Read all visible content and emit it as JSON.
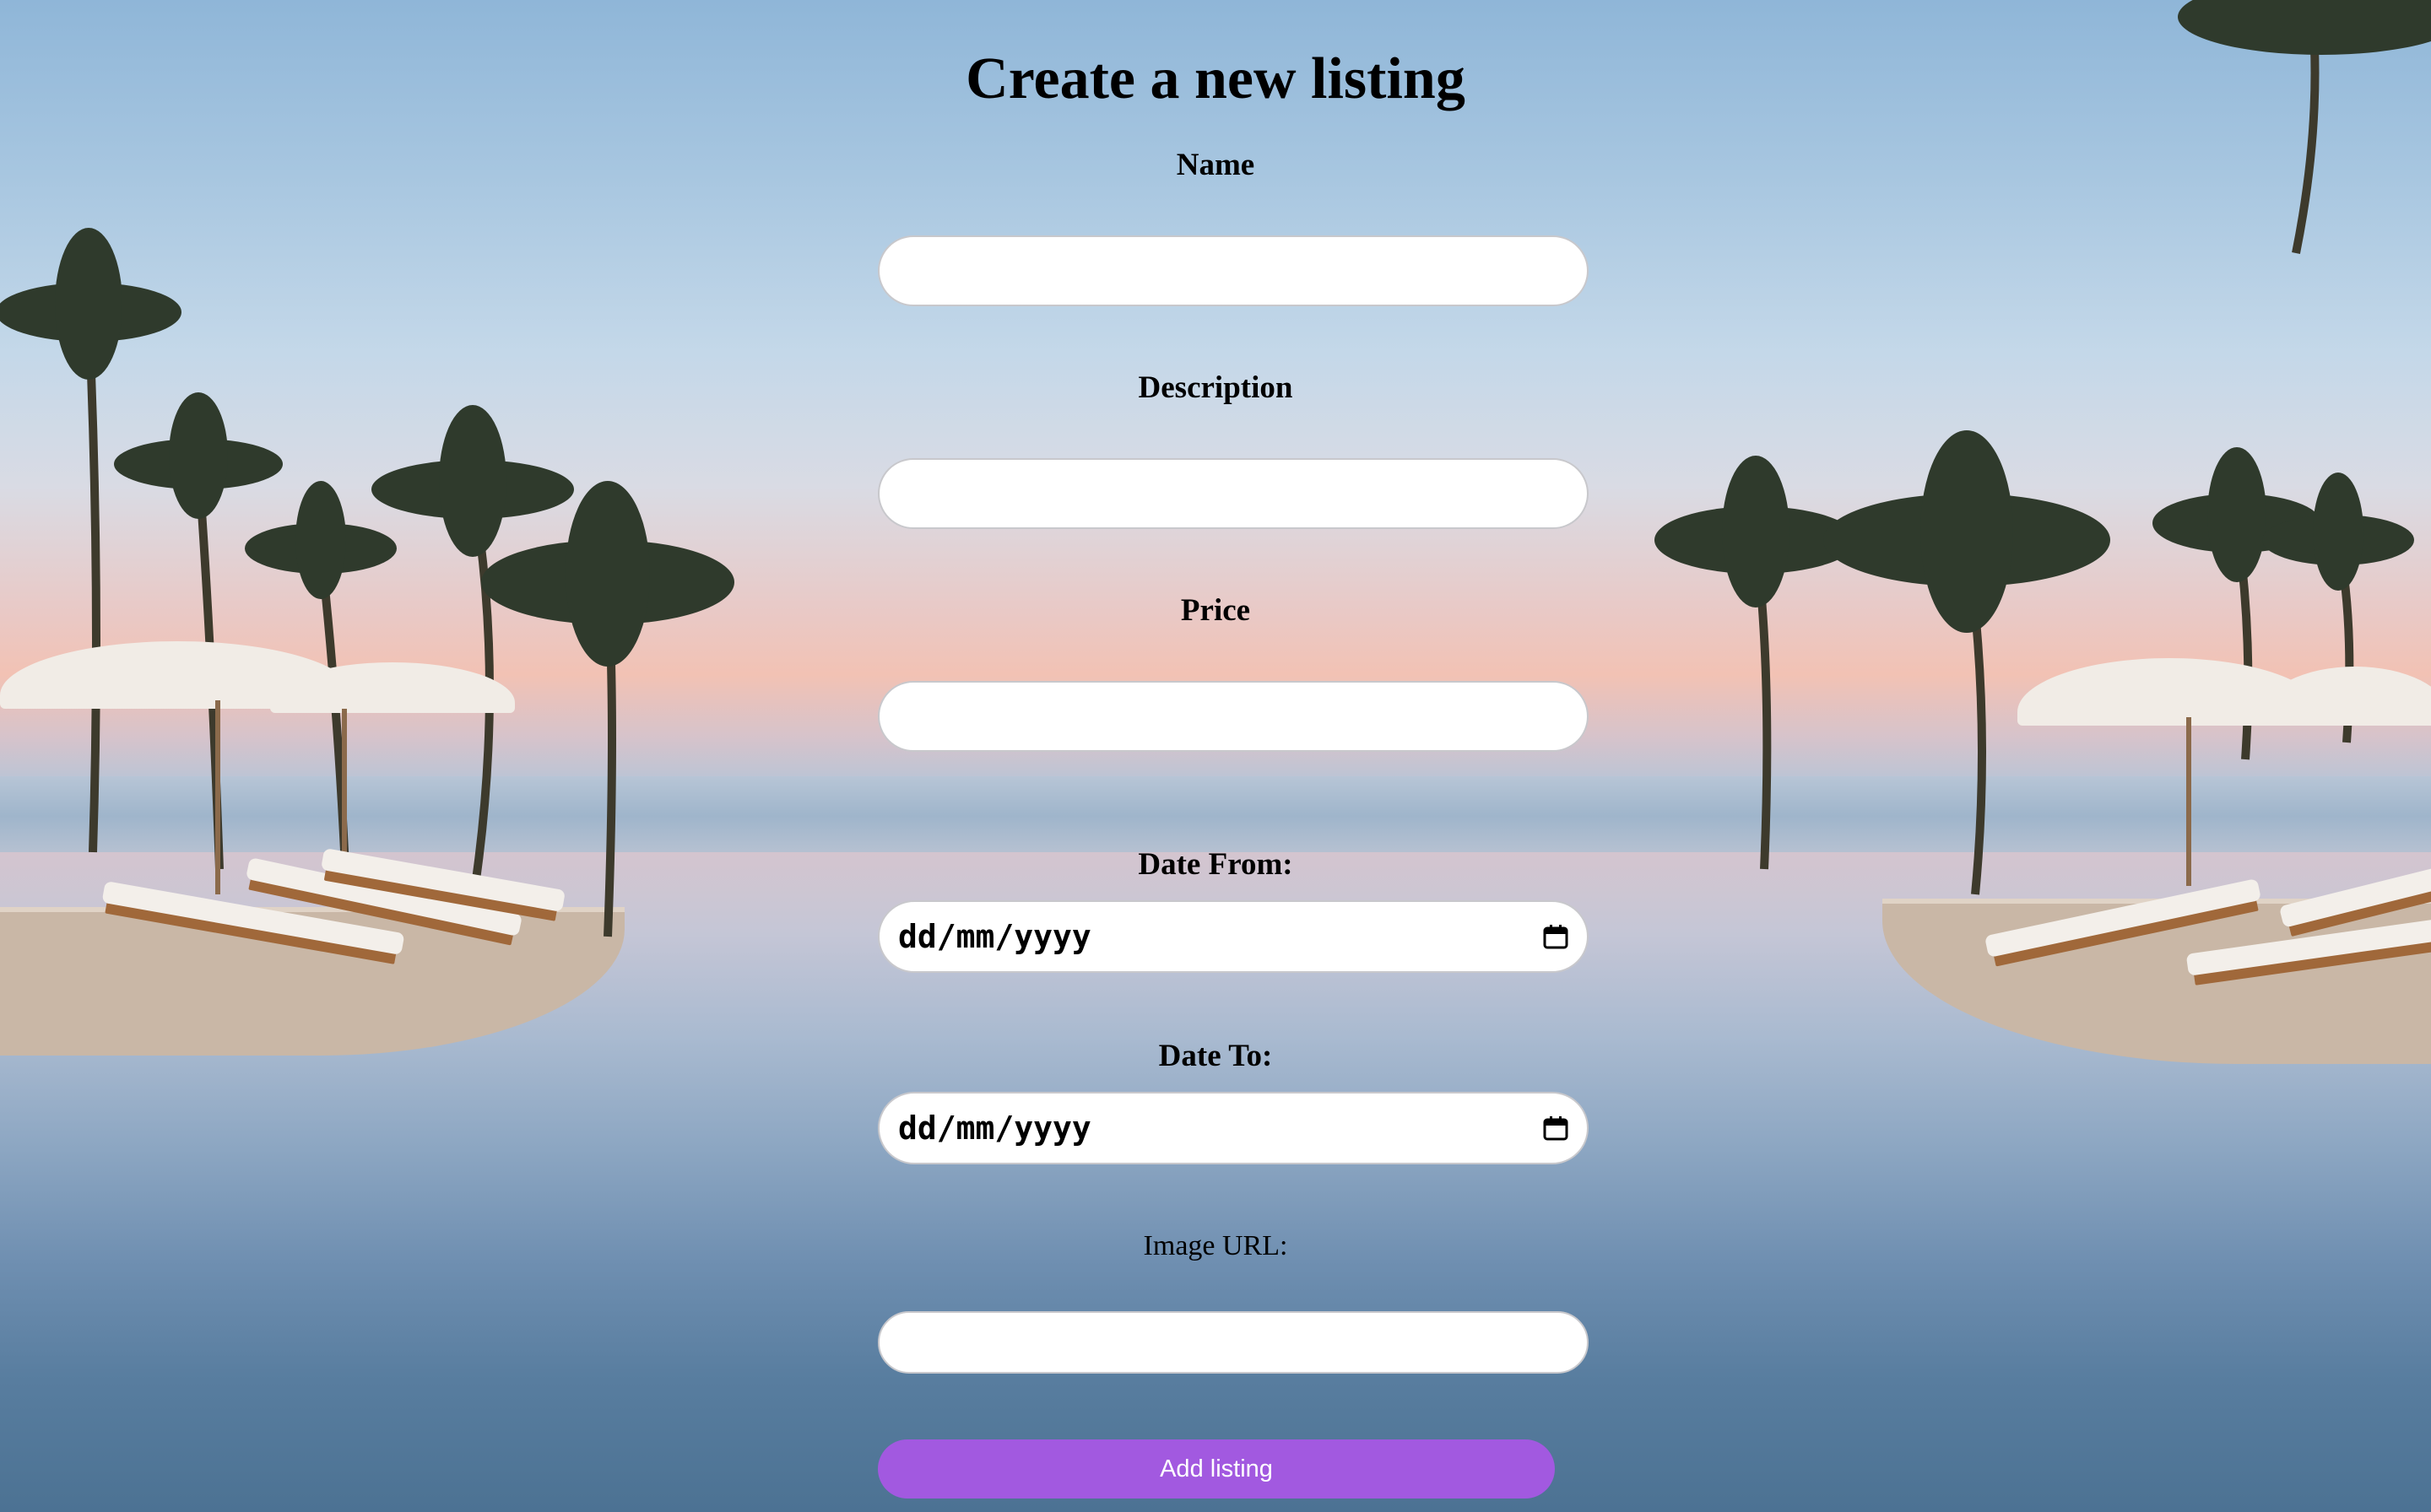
{
  "page": {
    "title": "Create a new listing"
  },
  "form": {
    "name": {
      "label": "Name",
      "value": ""
    },
    "description": {
      "label": "Description",
      "value": ""
    },
    "price": {
      "label": "Price",
      "value": ""
    },
    "date_from": {
      "label": "Date From:",
      "value": "dd/mm/yyyy"
    },
    "date_to": {
      "label": "Date To:",
      "value": "dd/mm/yyyy"
    },
    "image_url": {
      "label": "Image URL:",
      "value": ""
    },
    "submit_label": "Add listing"
  },
  "colors": {
    "button": "#a259e0",
    "button_text": "#ffffff",
    "field_bg": "#ffffff"
  },
  "background": {
    "scene": "infinity-pool-with-palm-trees-and-sun-loungers"
  }
}
